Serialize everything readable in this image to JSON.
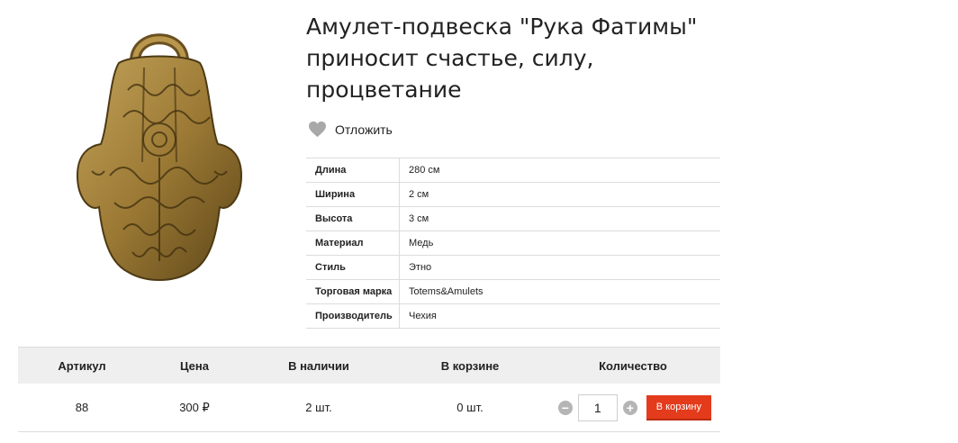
{
  "product": {
    "title": "Амулет-подвеска \"Рука Фатимы\" приносит счастье, силу, процветание",
    "wishlist_label": "Отложить"
  },
  "specs": [
    {
      "key": "Длина",
      "value": "280 см"
    },
    {
      "key": "Ширина",
      "value": "2 см"
    },
    {
      "key": "Высота",
      "value": "3 см"
    },
    {
      "key": "Материал",
      "value": "Медь"
    },
    {
      "key": "Стиль",
      "value": "Этно"
    },
    {
      "key": "Торговая марка",
      "value": "Totems&Amulets"
    },
    {
      "key": "Производитель",
      "value": "Чехия"
    }
  ],
  "purchase": {
    "headers": {
      "article": "Артикул",
      "price": "Цена",
      "in_stock": "В наличии",
      "in_cart": "В корзине",
      "quantity": "Количество"
    },
    "row": {
      "article": "88",
      "price": "300 ₽",
      "in_stock": "2 шт.",
      "in_cart": "0 шт.",
      "quantity": "1"
    },
    "minus_label": "−",
    "plus_label": "+",
    "add_to_cart_label": "В корзину"
  },
  "colors": {
    "accent_button": "#e33b1c",
    "heart": "#a8a8a8",
    "pendant": "#9c7a35"
  },
  "icons": {
    "wishlist": "heart-icon",
    "minus": "minus-circle-icon",
    "plus": "plus-circle-icon"
  }
}
